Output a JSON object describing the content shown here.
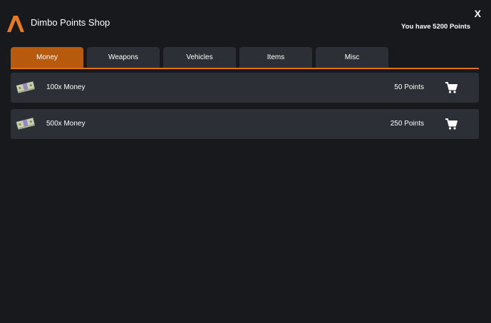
{
  "header": {
    "title": "Dimbo Points Shop",
    "close_label": "X",
    "balance_text": "You have 5200 Points",
    "logo_icon": "stylized-a-logo"
  },
  "tabs": [
    {
      "label": "Money",
      "active": true
    },
    {
      "label": "Weapons",
      "active": false
    },
    {
      "label": "Vehicles",
      "active": false
    },
    {
      "label": "Items",
      "active": false
    },
    {
      "label": "Misc",
      "active": false
    }
  ],
  "items": [
    {
      "name": "100x Money",
      "price": "50 Points",
      "icon": "money-stack-icon"
    },
    {
      "name": "500x Money",
      "price": "250 Points",
      "icon": "money-stack-icon"
    }
  ],
  "colors": {
    "background": "#18191d",
    "panel": "#2c2f35",
    "accent": "#d9731c",
    "active_tab": "#b85a0e"
  }
}
